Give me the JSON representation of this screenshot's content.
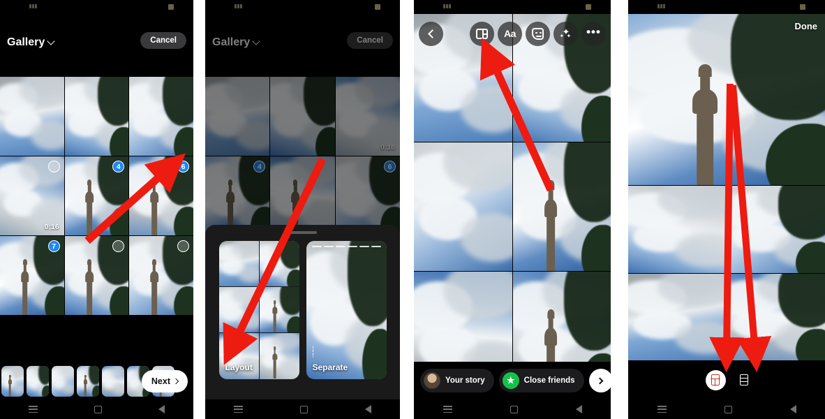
{
  "meta": {
    "app": "Instagram Story Creation",
    "panel_count": 4,
    "accent_blue": "#1c88f5",
    "arrow_red": "#ee1b10",
    "green": "#17c04b"
  },
  "panel1": {
    "name": "gallery-picker",
    "header": {
      "title": "Gallery",
      "cancel_label": "Cancel"
    },
    "grid": [
      {
        "id": "t1",
        "badge": "",
        "duration": "",
        "sky": "sky-a",
        "foliage": false
      },
      {
        "id": "t2",
        "badge": "",
        "duration": "",
        "sky": "sky-b",
        "foliage": true
      },
      {
        "id": "t3",
        "badge": "",
        "duration": "",
        "sky": "sky-c",
        "foliage": true
      },
      {
        "id": "t4",
        "badge": "",
        "duration": "0:16",
        "sky": "sky-d",
        "foliage": false,
        "badge_empty": true
      },
      {
        "id": "t5",
        "badge": "4",
        "duration": "",
        "sky": "sky-e",
        "foliage": true,
        "minaret": true
      },
      {
        "id": "t6",
        "badge": "6",
        "duration": "",
        "sky": "sky-f",
        "foliage": true,
        "minaret": true
      },
      {
        "id": "t7",
        "badge": "7",
        "duration": "",
        "sky": "sky-e",
        "foliage": true,
        "minaret": true
      },
      {
        "id": "t8",
        "badge": "",
        "duration": "",
        "sky": "sky-b",
        "foliage": true,
        "minaret": true,
        "badge_empty": true
      },
      {
        "id": "t9",
        "badge": "",
        "duration": "",
        "sky": "sky-c",
        "foliage": true,
        "minaret": true,
        "badge_empty": true
      }
    ],
    "filmstrip_count": 7,
    "next_label": "Next"
  },
  "panel2": {
    "name": "gallery-picker-with-sheet",
    "header": {
      "title": "Gallery",
      "cancel_label": "Cancel"
    },
    "grid": [
      {
        "id": "t1",
        "badge": "",
        "duration": "",
        "sky": "sky-a"
      },
      {
        "id": "t2",
        "badge": "",
        "duration": "",
        "sky": "sky-b",
        "foliage": true
      },
      {
        "id": "t3",
        "badge": "",
        "duration": "0:16",
        "sky": "sky-d"
      },
      {
        "id": "t4",
        "badge": "4",
        "duration": "",
        "sky": "sky-e",
        "minaret": true,
        "foliage": true
      },
      {
        "id": "t5",
        "badge": "",
        "duration": "",
        "sky": "sky-f",
        "minaret": true
      },
      {
        "id": "t6",
        "badge": "6",
        "duration": "",
        "sky": "sky-c",
        "foliage": true
      }
    ],
    "sheet": {
      "options": [
        {
          "label": "Layout",
          "icon": "layout-grid-icon"
        },
        {
          "label": "Separate",
          "icon": "separate-segments-icon"
        }
      ]
    }
  },
  "panel3": {
    "name": "story-editor",
    "toolbar": [
      {
        "label": "",
        "icon": "back-chevron-icon",
        "active": false
      },
      {
        "label": "",
        "icon": "layout-grid-icon",
        "active": true
      },
      {
        "label": "Aa",
        "icon": "text-aa-icon",
        "active": false
      },
      {
        "label": "",
        "icon": "sticker-icon",
        "active": false
      },
      {
        "label": "",
        "icon": "sparkles-icon",
        "active": false
      },
      {
        "label": "",
        "icon": "more-options-icon",
        "active": false
      }
    ],
    "collage_tiles": [
      "sky-a",
      "sky-b",
      "sky-c",
      "sky-e",
      "sky-f",
      "sky-d"
    ],
    "footer": {
      "your_story_label": "Your story",
      "close_friends_label": "Close friends",
      "send_icon": "chevron-right-icon"
    }
  },
  "panel4": {
    "name": "layout-selection",
    "done_label": "Done",
    "hero_sky": "sky-e",
    "grid_tiles": [
      "sky-b",
      "sky-c",
      "sky-a",
      "sky-f"
    ],
    "layout_options": [
      {
        "id": "grid-layout",
        "icon": "grid-layout-icon",
        "selected": true
      },
      {
        "id": "rows-layout",
        "icon": "rows-layout-icon",
        "selected": false
      }
    ]
  },
  "navbar": {
    "recents": "recents-icon",
    "home": "home-icon",
    "back": "back-icon"
  }
}
